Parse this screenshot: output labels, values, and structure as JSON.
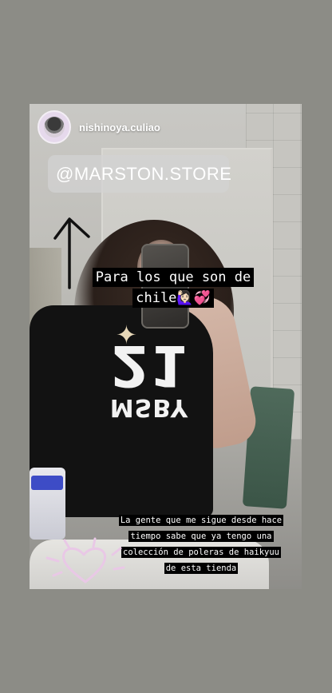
{
  "story": {
    "username": "nishinoya.culiao",
    "avatar_icon": "avatar-image",
    "mention_sticker": "@MARSTON.STORE",
    "caption_top": {
      "line1": "Para los que son de",
      "line2": "chile🙋🏻‍♀️💞"
    },
    "caption_bottom": {
      "line1": "La gente que me sigue desde hace",
      "line2": "tiempo sabe que ya tengo una",
      "line3": "colección de poleras de haikyuu",
      "line4": "de esta tienda"
    },
    "shirt_print": {
      "word": "MSBY",
      "number": "21"
    },
    "decorations": [
      "up-arrow-doodle",
      "heart-doodle"
    ],
    "colors": {
      "page_background": "#8c8c86",
      "caption_background": "#000000",
      "caption_text": "#ffffff",
      "doodle_pink": "#e9c8e6",
      "arrow_black": "#111111"
    }
  }
}
